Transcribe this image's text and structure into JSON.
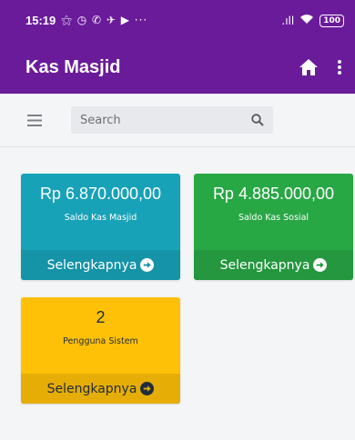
{
  "status_bar": {
    "time": "15:19",
    "notification_glyphs": "⚝ ◷ ✆ ✈ ▶ ···",
    "signal_text": ".ıll",
    "battery": "100"
  },
  "app_bar": {
    "title": "Kas Masjid"
  },
  "search": {
    "placeholder": "Search"
  },
  "colors": {
    "primary": "#6a1b9a",
    "card_teal": "#17a2b8",
    "card_green": "#28a745",
    "card_yellow": "#ffc107"
  },
  "cards": [
    {
      "value": "Rp 6.870.000,00",
      "label": "Saldo Kas Masjid",
      "link": "Selengkapnya"
    },
    {
      "value": "Rp 4.885.000,00",
      "label": "Saldo Kas Sosial",
      "link": "Selengkapnya"
    },
    {
      "value": "2",
      "label": "Pengguna Sistem",
      "link": "Selengkapnya"
    }
  ]
}
